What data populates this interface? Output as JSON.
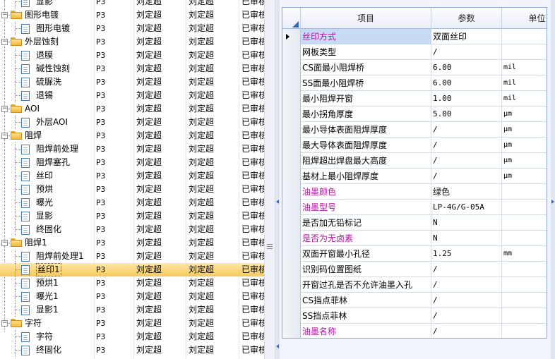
{
  "tree": {
    "code_column_value": "P3",
    "rows": [
      {
        "kind": "leaf",
        "level": 2,
        "label": "显影",
        "code": "P3",
        "owner": "刘定超",
        "reviewer": "刘定超",
        "status": "已审核"
      },
      {
        "kind": "group",
        "level": 1,
        "label": "图形电镀",
        "code": "P3",
        "owner": "刘定超",
        "reviewer": "刘定超",
        "status": "已审核"
      },
      {
        "kind": "leaf",
        "level": 2,
        "label": "图形电镀",
        "code": "P3",
        "owner": "刘定超",
        "reviewer": "刘定超",
        "status": "已审核"
      },
      {
        "kind": "group",
        "level": 1,
        "label": "外层蚀刻",
        "code": "P3",
        "owner": "刘定超",
        "reviewer": "刘定超",
        "status": "已审核"
      },
      {
        "kind": "leaf",
        "level": 2,
        "label": "退膜",
        "code": "P3",
        "owner": "刘定超",
        "reviewer": "刘定超",
        "status": "已审核"
      },
      {
        "kind": "leaf",
        "level": 2,
        "label": "碱性蚀刻",
        "code": "P3",
        "owner": "刘定超",
        "reviewer": "刘定超",
        "status": "已审核"
      },
      {
        "kind": "leaf",
        "level": 2,
        "label": "硫脲洗",
        "code": "P3",
        "owner": "刘定超",
        "reviewer": "刘定超",
        "status": "已审核"
      },
      {
        "kind": "leaf",
        "level": 2,
        "label": "退锡",
        "code": "P3",
        "owner": "刘定超",
        "reviewer": "刘定超",
        "status": "已审核"
      },
      {
        "kind": "group",
        "level": 1,
        "label": "AOI",
        "code": "P3",
        "owner": "刘定超",
        "reviewer": "刘定超",
        "status": "已审核"
      },
      {
        "kind": "leaf",
        "level": 2,
        "label": "外层AOI",
        "code": "P3",
        "owner": "刘定超",
        "reviewer": "刘定超",
        "status": "已审核"
      },
      {
        "kind": "group",
        "level": 1,
        "label": "阻焊",
        "code": "P3",
        "owner": "刘定超",
        "reviewer": "刘定超",
        "status": "已审核"
      },
      {
        "kind": "leaf",
        "level": 2,
        "label": "阻焊前处理",
        "code": "P3",
        "owner": "刘定超",
        "reviewer": "刘定超",
        "status": "已审核"
      },
      {
        "kind": "leaf",
        "level": 2,
        "label": "阻焊塞孔",
        "code": "P3",
        "owner": "刘定超",
        "reviewer": "刘定超",
        "status": "已审核"
      },
      {
        "kind": "leaf",
        "level": 2,
        "label": "丝印",
        "code": "P3",
        "owner": "刘定超",
        "reviewer": "刘定超",
        "status": "已审核"
      },
      {
        "kind": "leaf",
        "level": 2,
        "label": "预烘",
        "code": "P3",
        "owner": "刘定超",
        "reviewer": "刘定超",
        "status": "已审核"
      },
      {
        "kind": "leaf",
        "level": 2,
        "label": "曝光",
        "code": "P3",
        "owner": "刘定超",
        "reviewer": "刘定超",
        "status": "已审核"
      },
      {
        "kind": "leaf",
        "level": 2,
        "label": "显影",
        "code": "P3",
        "owner": "刘定超",
        "reviewer": "刘定超",
        "status": "已审核"
      },
      {
        "kind": "leaf",
        "level": 2,
        "label": "终固化",
        "code": "P3",
        "owner": "刘定超",
        "reviewer": "刘定超",
        "status": "已审核"
      },
      {
        "kind": "group",
        "level": 1,
        "label": "阻焊1",
        "code": "P3",
        "owner": "刘定超",
        "reviewer": "刘定超",
        "status": "已审核"
      },
      {
        "kind": "leaf",
        "level": 2,
        "label": "阻焊前处理1",
        "code": "P3",
        "owner": "刘定超",
        "reviewer": "刘定超",
        "status": "已审核"
      },
      {
        "kind": "leaf",
        "level": 2,
        "label": "丝印1",
        "code": "P3",
        "owner": "刘定超",
        "reviewer": "刘定超",
        "status": "已审核",
        "selected": true
      },
      {
        "kind": "leaf",
        "level": 2,
        "label": "预烘1",
        "code": "P3",
        "owner": "刘定超",
        "reviewer": "刘定超",
        "status": "已审核"
      },
      {
        "kind": "leaf",
        "level": 2,
        "label": "曝光1",
        "code": "P3",
        "owner": "刘定超",
        "reviewer": "刘定超",
        "status": "已审核"
      },
      {
        "kind": "leaf",
        "level": 2,
        "label": "显影1",
        "code": "P3",
        "owner": "刘定超",
        "reviewer": "刘定超",
        "status": "已审核"
      },
      {
        "kind": "group",
        "level": 1,
        "label": "字符",
        "code": "P3",
        "owner": "刘定超",
        "reviewer": "刘定超",
        "status": "已审核"
      },
      {
        "kind": "leaf",
        "level": 2,
        "label": "字符",
        "code": "P3",
        "owner": "刘定超",
        "reviewer": "刘定超",
        "status": "已审核"
      },
      {
        "kind": "leaf",
        "level": 2,
        "label": "终固化",
        "code": "P3",
        "owner": "刘定超",
        "reviewer": "刘定超",
        "status": "已审核"
      }
    ]
  },
  "params": {
    "headers": {
      "item": "项目",
      "value": "参数",
      "unit": "单位"
    },
    "rows": [
      {
        "item": "丝印方式",
        "value": "双面丝印",
        "unit": "",
        "highlight": true,
        "magenta": true,
        "current": true
      },
      {
        "item": "网板类型",
        "value": "/",
        "unit": ""
      },
      {
        "item": "CS面最小阻焊桥",
        "value": "6.00",
        "unit": "mil"
      },
      {
        "item": "SS面最小阻焊桥",
        "value": "6.00",
        "unit": "mil"
      },
      {
        "item": "最小阻焊开窗",
        "value": "1.00",
        "unit": "mil"
      },
      {
        "item": "最小拐角厚度",
        "value": "5.00",
        "unit": "μm"
      },
      {
        "item": "最小导体表面阻焊厚度",
        "value": "/",
        "unit": "μm"
      },
      {
        "item": "最大导体表面阻焊厚度",
        "value": "/",
        "unit": "μm"
      },
      {
        "item": "阻焊超出焊盘最大高度",
        "value": "/",
        "unit": "μm"
      },
      {
        "item": "基材上最小阻焊厚度",
        "value": "/",
        "unit": "μm"
      },
      {
        "item": "油墨颜色",
        "value": "绿色",
        "unit": "",
        "magenta": true
      },
      {
        "item": "油墨型号",
        "value": "LP-4G/G-05A",
        "unit": "",
        "magenta": true
      },
      {
        "item": "是否加无铅标记",
        "value": "N",
        "unit": ""
      },
      {
        "item": "是否为无卤素",
        "value": "N",
        "unit": "",
        "magenta": true
      },
      {
        "item": "双面开窗最小孔径",
        "value": "1.25",
        "unit": "mm"
      },
      {
        "item": "识别码位置图纸",
        "value": "/",
        "unit": ""
      },
      {
        "item": "开窗过孔是否不允许油墨入孔",
        "value": "/",
        "unit": ""
      },
      {
        "item": "CS挡点菲林",
        "value": "/",
        "unit": ""
      },
      {
        "item": "SS挡点菲林",
        "value": "/",
        "unit": ""
      },
      {
        "item": "油墨名称",
        "value": "/",
        "unit": "",
        "magenta": true
      }
    ]
  },
  "colors": {
    "magenta_label": "#b0169e",
    "selection_bg": "#f7c95a",
    "grid_border": "#8ea6cf"
  }
}
